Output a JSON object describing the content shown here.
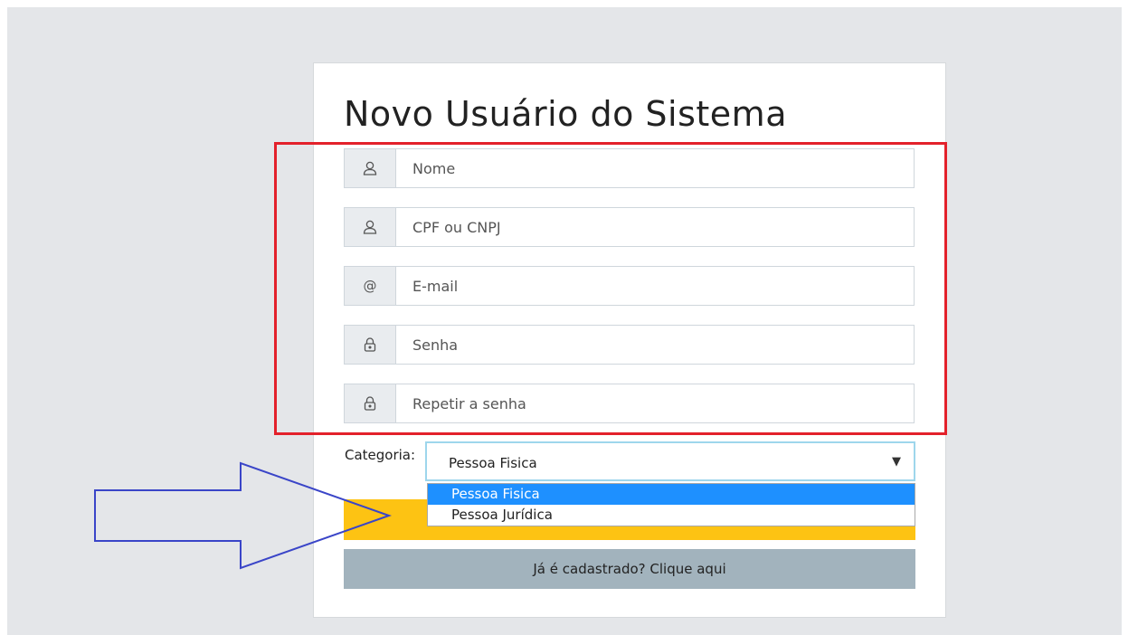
{
  "page": {
    "title": "Novo Usuário do Sistema"
  },
  "form": {
    "fields": [
      {
        "icon": "user-icon",
        "placeholder": "Nome",
        "value": ""
      },
      {
        "icon": "user-icon",
        "placeholder": "CPF ou CNPJ",
        "value": ""
      },
      {
        "icon": "at-icon",
        "placeholder": "E-mail",
        "value": "",
        "symbol": "@"
      },
      {
        "icon": "lock-icon",
        "placeholder": "Senha",
        "value": ""
      },
      {
        "icon": "lock-icon",
        "placeholder": "Repetir a senha",
        "value": ""
      }
    ],
    "category": {
      "label": "Categoria:",
      "selected": "Pessoa Fisica",
      "caret": "▼",
      "options": [
        "Pessoa Fisica",
        "Pessoa Jurídica"
      ]
    },
    "secondary_button": "Já é cadastrado? Clique aqui"
  },
  "colors": {
    "highlight_box": "#e3212b",
    "annotation_arrow": "#3a45c8",
    "primary_button": "#fdc313",
    "secondary_button": "#a2b3bd",
    "dropdown_selected": "#1e90ff"
  }
}
